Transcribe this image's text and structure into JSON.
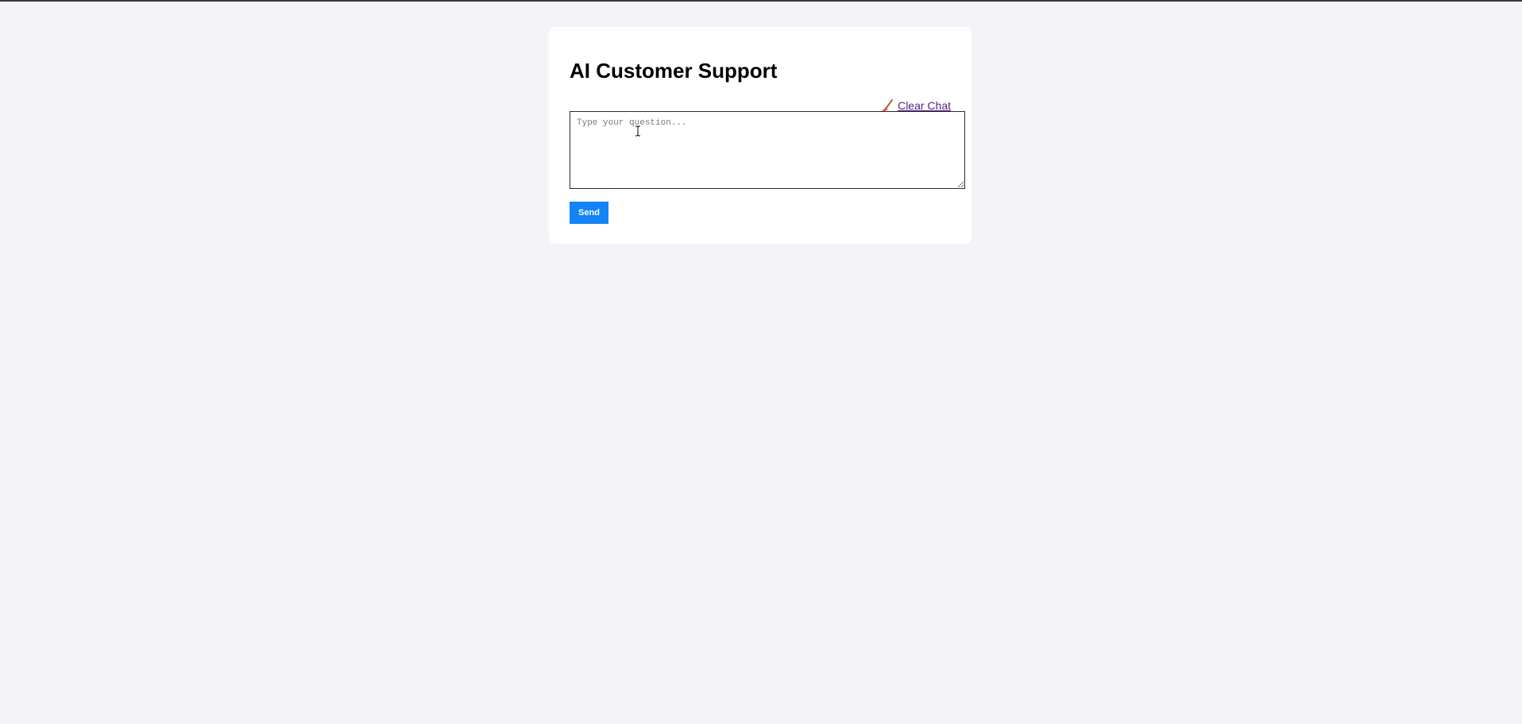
{
  "page": {
    "title": "AI Customer Support"
  },
  "toolbar": {
    "clear_label": "Clear Chat",
    "clear_icon": "broom-icon"
  },
  "input": {
    "placeholder": "Type your question...",
    "value": ""
  },
  "actions": {
    "send_label": "Send"
  },
  "colors": {
    "background": "#f4f3f7",
    "card": "#ffffff",
    "send_button": "#1383f7",
    "link_visited": "#551a8b"
  }
}
